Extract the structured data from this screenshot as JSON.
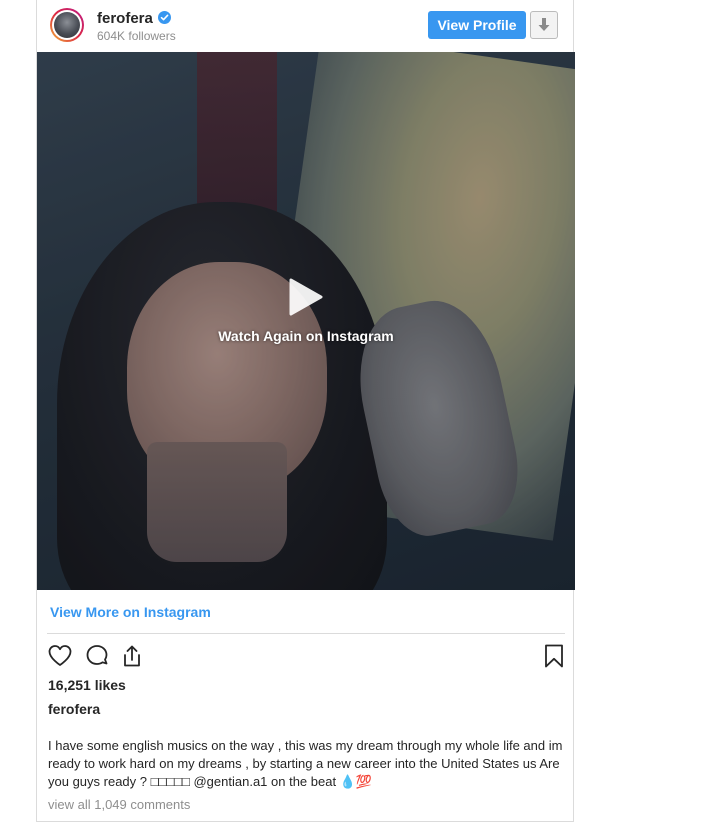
{
  "post": {
    "username": "ferofera",
    "followers": "604K followers",
    "view_profile_label": "View Profile",
    "media": {
      "overlay_text": "Watch Again on Instagram"
    },
    "view_more_label": "View More on Instagram",
    "likes": "16,251 likes",
    "caption_username": "ferofera",
    "caption": "I have some english musics on the way , this was my dream through my whole life and im ready to work hard on my dreams , by starting a new career into the United States us Are you guys ready ? □□□□□ @gentian.a1 on the beat 💧💯",
    "comments_link": "view all 1,049 comments"
  },
  "colors": {
    "accent": "#3897f0",
    "muted": "#8e8e8e",
    "text": "#262626",
    "border": "#dbdbdb"
  },
  "icons": {
    "verified": "verified-badge-icon",
    "download": "download-arrow-icon",
    "play": "play-icon",
    "like": "heart-icon",
    "comment": "comment-bubble-icon",
    "share": "share-icon",
    "save": "bookmark-icon"
  }
}
